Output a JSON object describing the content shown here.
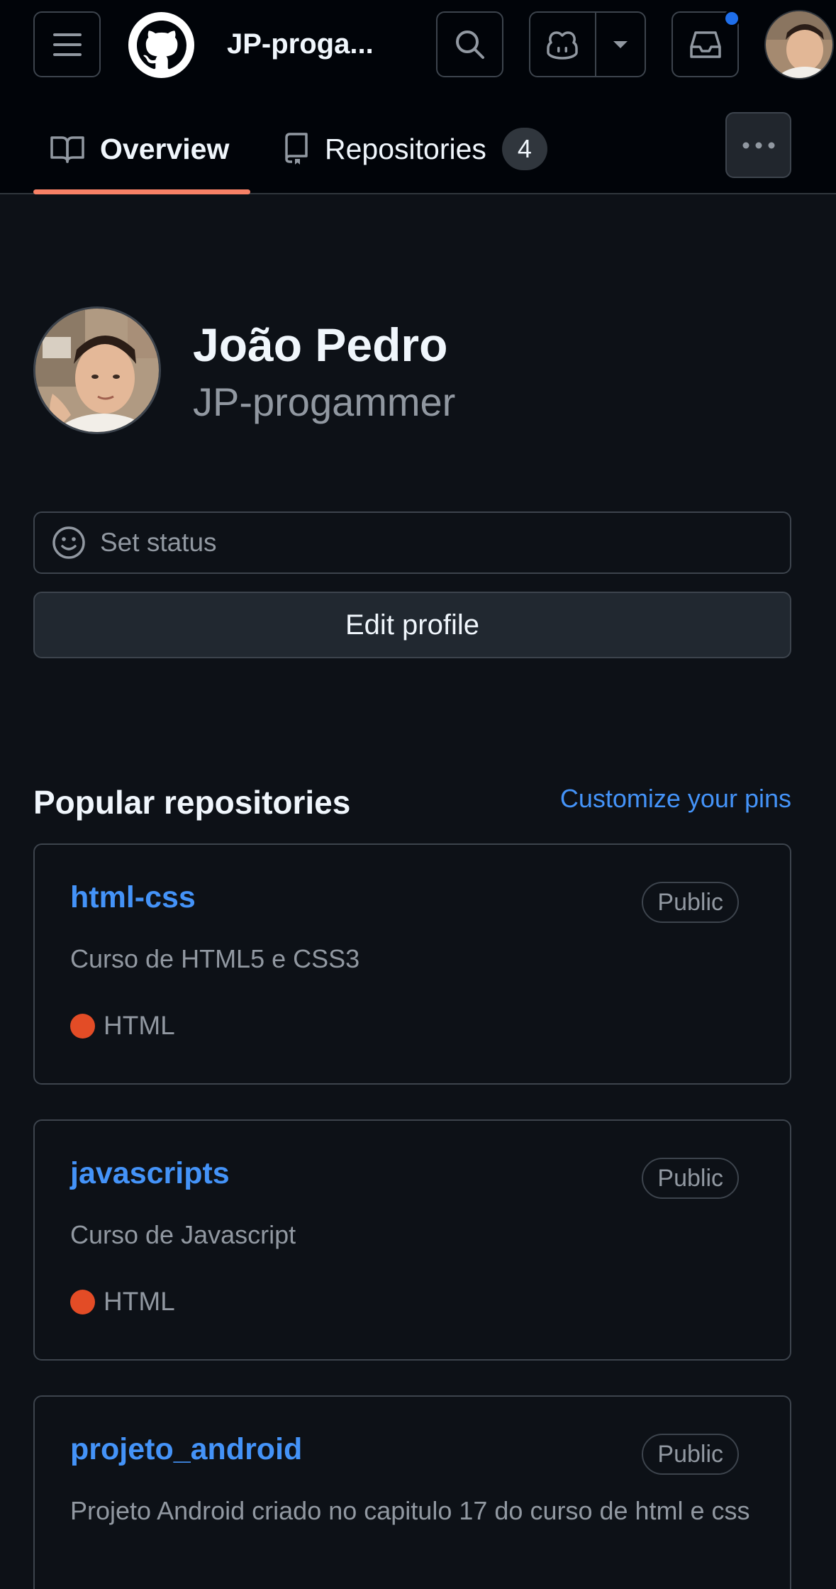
{
  "header": {
    "username_short": "JP-proga...",
    "icons": {
      "menu": "hamburger-icon",
      "logo": "github-mark-icon",
      "search": "search-icon",
      "copilot": "copilot-icon",
      "dropdown": "triangle-down-icon",
      "inbox": "inbox-icon"
    },
    "has_notification": true,
    "notification_color": "#1f6feb"
  },
  "tabs": [
    {
      "label": "Overview",
      "icon": "book-icon",
      "selected": true
    },
    {
      "label": "Repositories",
      "icon": "repo-icon",
      "count": "4",
      "selected": false
    }
  ],
  "profile": {
    "name": "João Pedro",
    "login": "JP-progammer",
    "status_placeholder": "Set status",
    "edit_label": "Edit profile"
  },
  "popular": {
    "title": "Popular repositories",
    "customize_label": "Customize your pins",
    "repos": [
      {
        "name": "html-css",
        "visibility": "Public",
        "description": "Curso de HTML5 e CSS3",
        "language": "HTML",
        "language_color": "#e34c26"
      },
      {
        "name": "javascripts",
        "visibility": "Public",
        "description": "Curso de Javascript",
        "language": "HTML",
        "language_color": "#e34c26"
      },
      {
        "name": "projeto_android",
        "visibility": "Public",
        "description": "Projeto Android criado no capitulo 17 do curso de html e css",
        "language": "",
        "language_color": ""
      }
    ]
  },
  "colors": {
    "background": "#0d1117",
    "header_bg": "#010409",
    "accent_link": "#4493f8",
    "tab_underline": "#f78166"
  }
}
